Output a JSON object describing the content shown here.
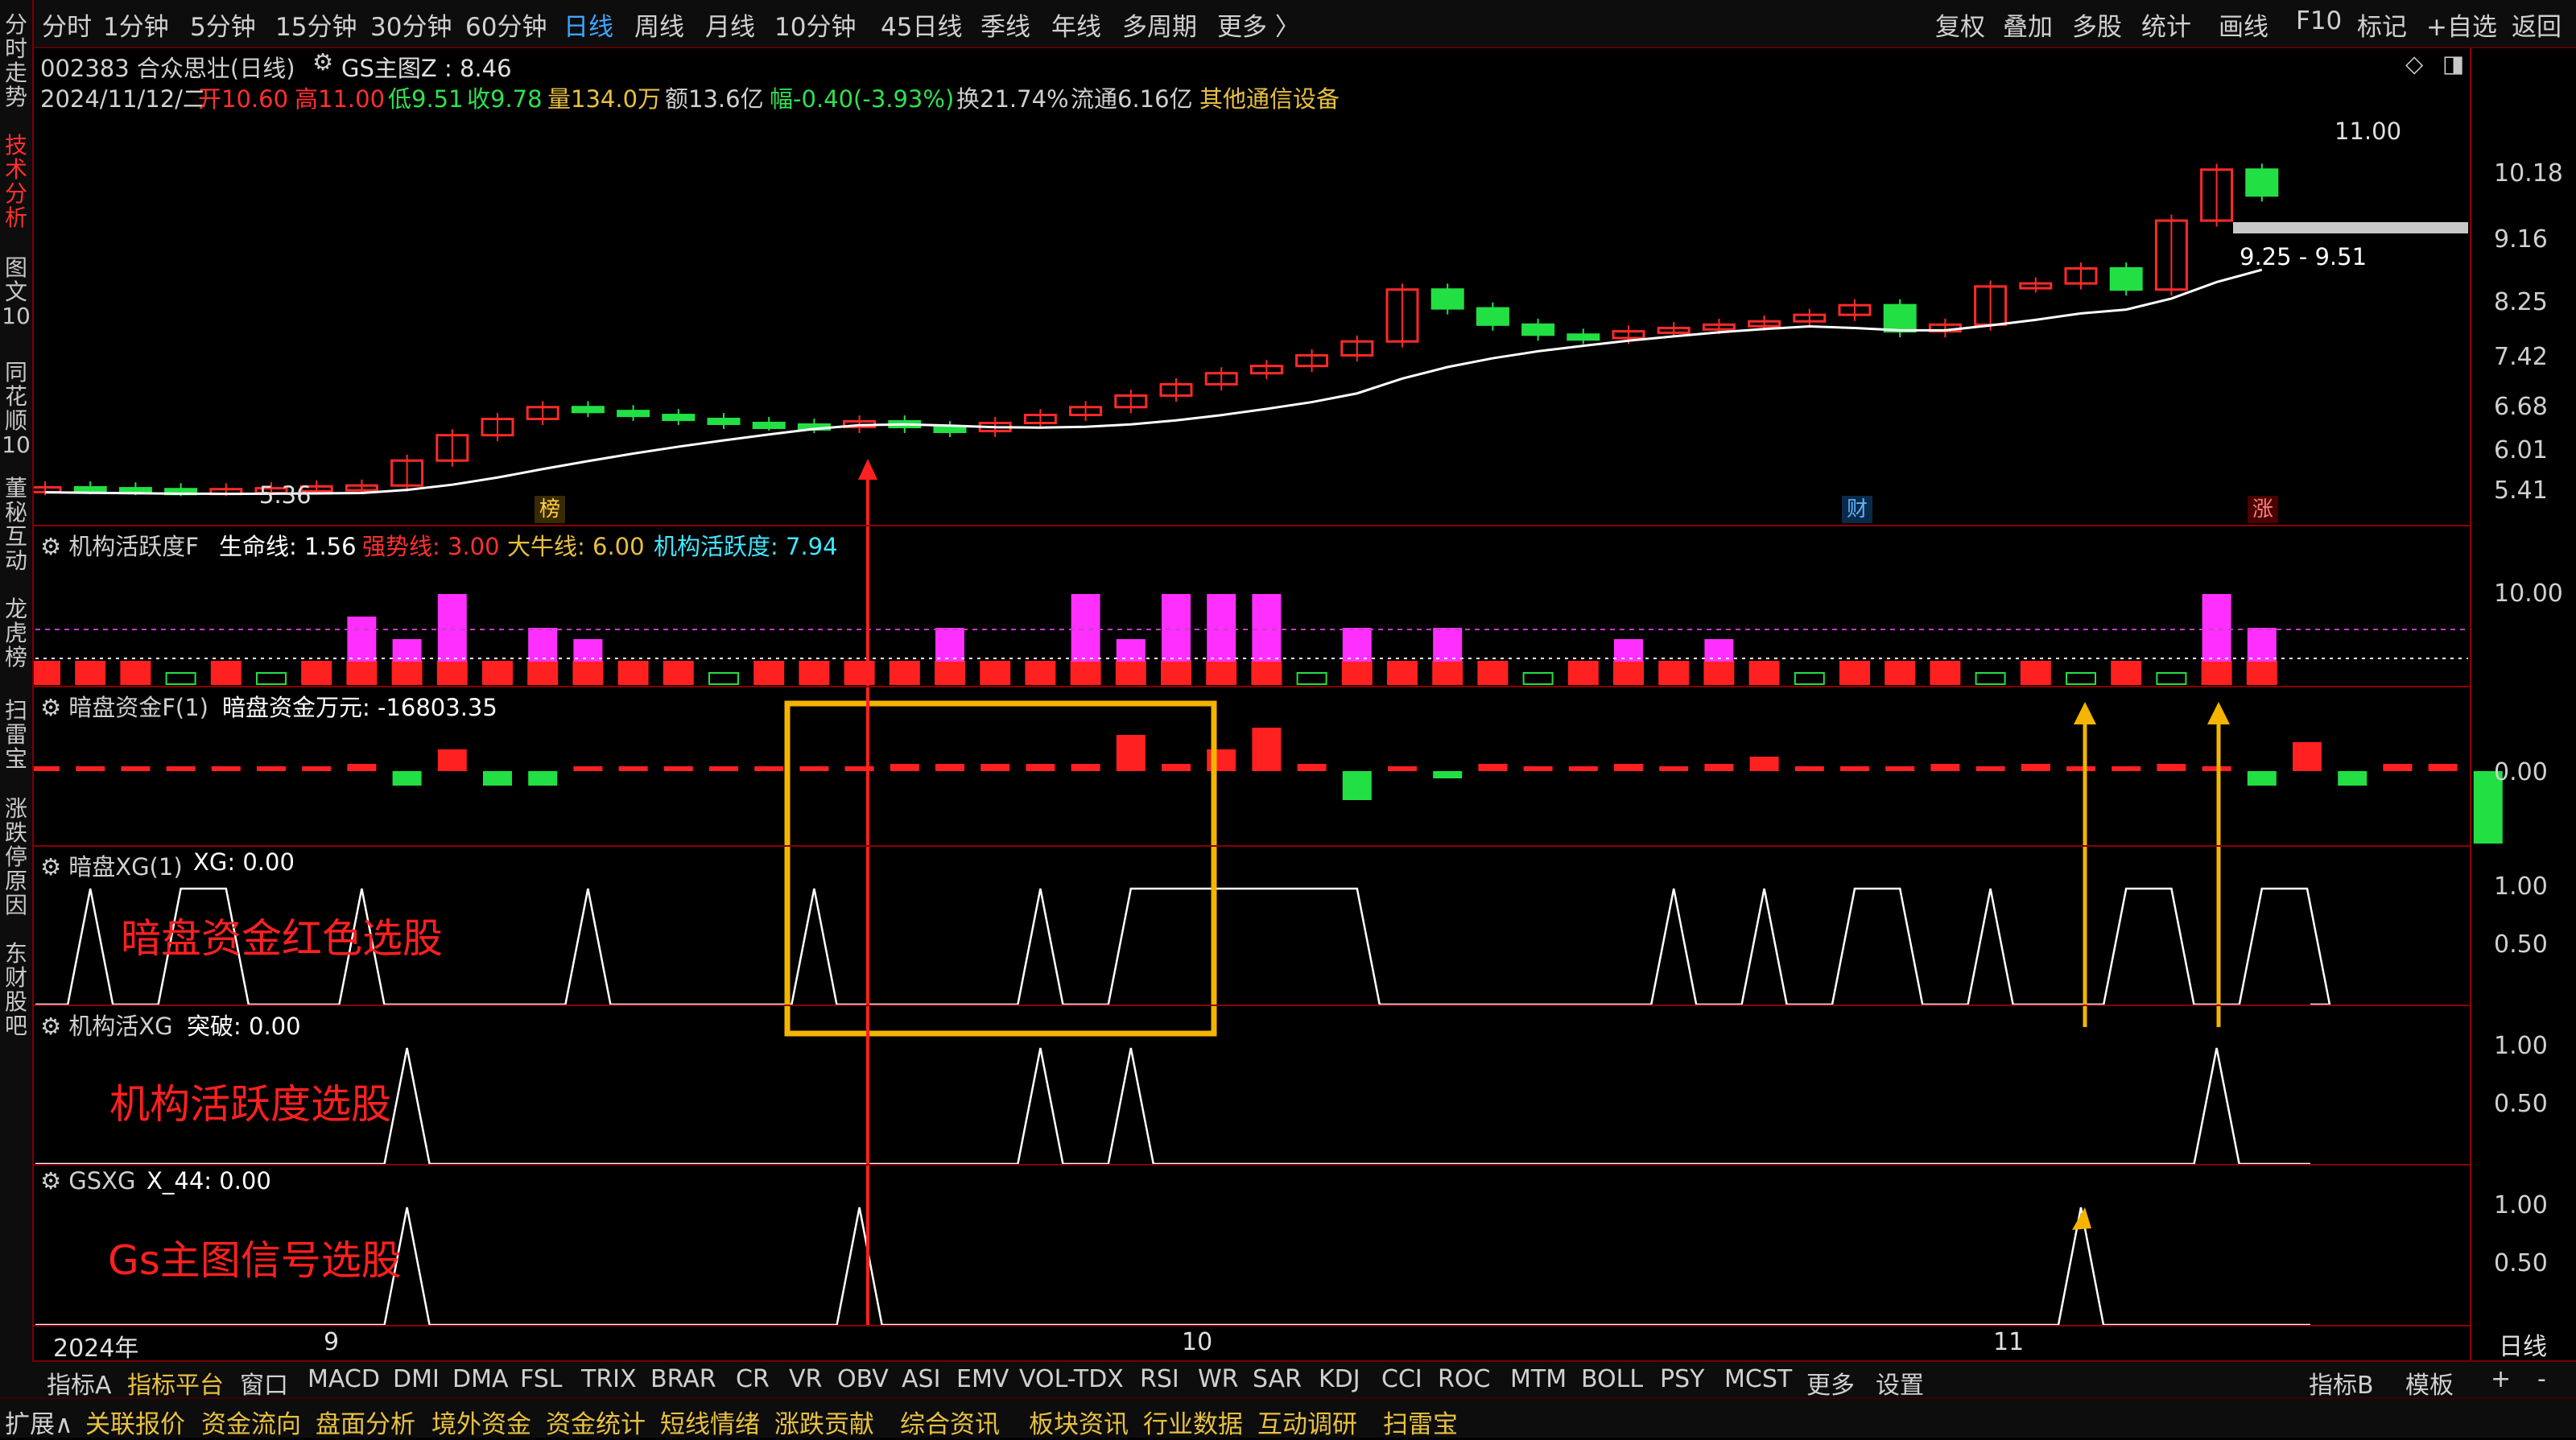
{
  "topbar": {
    "periods": [
      "分时",
      "1分钟",
      "5分钟",
      "15分钟",
      "30分钟",
      "60分钟",
      "日线",
      "周线",
      "月线",
      "10分钟",
      "45日线",
      "季线",
      "年线",
      "多周期",
      "更多 〉"
    ],
    "active_period": "日线",
    "tools": [
      "复权",
      "叠加",
      "多股",
      "统计",
      "画线",
      "F10",
      "标记",
      "+自选",
      "返回"
    ]
  },
  "leftbar": {
    "tabs": [
      "分时走势",
      "技术分析",
      "图文10",
      "同花顺10",
      "董秘互动",
      "龙虎榜",
      "扫雷宝",
      "涨跌停原因",
      "东财股吧"
    ],
    "active": "技术分析"
  },
  "stock": {
    "title_line": "002383 合众思壮(日线)",
    "indicator": "GS主图Z : 8.46",
    "date": "2024/11/12/二",
    "open": "开10.60",
    "high": "高11.00",
    "low": "低9.51",
    "close": "收9.78",
    "volume": "量134.0万",
    "amount": "额13.6亿",
    "change": "幅-0.40(-3.93%)",
    "turnover": "换21.74%",
    "float_cap": "流通6.16亿",
    "sector": "其他通信设备"
  },
  "main_chart": {
    "y_ticks": [
      "10.18",
      "9.16",
      "8.25",
      "7.42",
      "6.68",
      "6.01",
      "5.41"
    ],
    "high_label": "11.00",
    "low_label": "5.36",
    "range_label": "9.25 - 9.51",
    "event_markers": [
      "榜",
      "财",
      "涨"
    ]
  },
  "panes": {
    "p1": {
      "name": "机构活跃度F",
      "l1": "生命线: 1.56",
      "l2": "强势线: 3.00",
      "l3": "大牛线: 6.00",
      "l4": "机构活跃度: 7.94",
      "ticks": [
        "10.00"
      ]
    },
    "p2": {
      "name": "暗盘资金F(1)",
      "l1": "暗盘资金万元: -16803.35",
      "ticks": [
        "0.00"
      ]
    },
    "p3": {
      "name": "暗盘XG(1)",
      "l1": "XG: 0.00",
      "ticks": [
        "1.00",
        "0.50"
      ]
    },
    "p4": {
      "name": "机构活XG",
      "l1": "突破: 0.00",
      "ticks": [
        "1.00",
        "0.50"
      ]
    },
    "p5": {
      "name": "GSXG",
      "l1": "X_44: 0.00",
      "ticks": [
        "1.00",
        "0.50"
      ]
    }
  },
  "annotations": {
    "a1": "暗盘资金红色选股",
    "a2": "机构活跃度选股",
    "a3": "Gs主图信号选股"
  },
  "x_axis": {
    "year": "2024年",
    "months": [
      "9",
      "10",
      "11"
    ],
    "period_label": "日线"
  },
  "bottom_tabs": [
    "指标A",
    "指标平台",
    "窗口",
    "MACD",
    "DMI",
    "DMA",
    "FSL",
    "TRIX",
    "BRAR",
    "CR",
    "VR",
    "OBV",
    "ASI",
    "EMV",
    "VOL-TDX",
    "RSI",
    "WR",
    "SAR",
    "KDJ",
    "CCI",
    "ROC",
    "MTM",
    "BOLL",
    "PSY",
    "MCST",
    "更多",
    "设置"
  ],
  "bottom_right": [
    "指标B",
    "模板",
    "+",
    "-"
  ],
  "status_tabs": [
    "扩展∧",
    "关联报价",
    "资金流向",
    "盘面分析",
    "境外资金",
    "资金统计",
    "短线情绪",
    "涨跌贡献",
    "综合资讯",
    "板块资讯",
    "行业数据",
    "互动调研",
    "扫雷宝"
  ],
  "colors": {
    "up": "#ff2a2a",
    "down": "#22e044",
    "ma": "#ffffff",
    "magenta": "#ff30ff",
    "orange": "#f5b400",
    "accent": "#3ea6ff"
  }
}
